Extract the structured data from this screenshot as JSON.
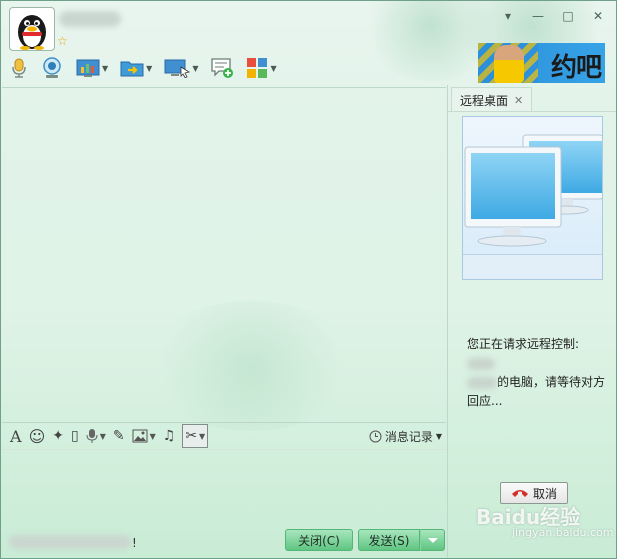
{
  "window": {
    "contact_name": "",
    "controls": {
      "minimize": "▾",
      "restore": "—",
      "maximize": "□",
      "close": "✕"
    }
  },
  "toolbar": {
    "items": [
      {
        "name": "voice-call",
        "icon": "microphone-icon"
      },
      {
        "name": "video-call",
        "icon": "webcam-icon"
      },
      {
        "name": "apps",
        "icon": "chart-icon"
      },
      {
        "name": "file-transfer",
        "icon": "folder-send-icon"
      },
      {
        "name": "remote-desktop",
        "icon": "monitor-cursor-icon"
      },
      {
        "name": "create-group-chat",
        "icon": "chat-add-icon"
      },
      {
        "name": "more-apps",
        "icon": "grid-icon"
      }
    ]
  },
  "ad": {
    "text": "约吧"
  },
  "input_toolbar": {
    "items": [
      {
        "name": "font",
        "glyph": "A"
      },
      {
        "name": "emoji",
        "glyph": "☺"
      },
      {
        "name": "poke",
        "glyph": "✦"
      },
      {
        "name": "shake",
        "glyph": "▯"
      },
      {
        "name": "voice-message",
        "glyph": "🎤"
      },
      {
        "name": "note",
        "glyph": "✎"
      },
      {
        "name": "image",
        "glyph": "▣"
      },
      {
        "name": "music",
        "glyph": "♫"
      },
      {
        "name": "screenshot",
        "glyph": "✂"
      }
    ],
    "message_record_label": "消息记录"
  },
  "bottom": {
    "status_suffix": "!",
    "close_label": "关闭(C)",
    "send_label": "发送(S)"
  },
  "side_panel": {
    "tab_label": "远程桌面",
    "tab_close": "✕",
    "request_text_1": "您正在请求远程控制:",
    "request_text_2": "的电脑，请等待对方回应...",
    "cancel_label": "取消"
  },
  "watermark": {
    "text": "Baidu经验",
    "sub": "jingyan.baidu.com"
  },
  "colors": {
    "accent_green": "#5fc581",
    "ad_blue": "#2b8fd9",
    "cancel_red": "#d0312d"
  }
}
